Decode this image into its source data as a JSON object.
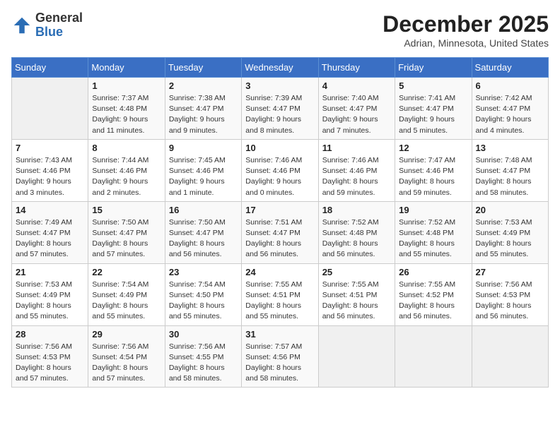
{
  "logo": {
    "general": "General",
    "blue": "Blue"
  },
  "header": {
    "title": "December 2025",
    "subtitle": "Adrian, Minnesota, United States"
  },
  "days_of_week": [
    "Sunday",
    "Monday",
    "Tuesday",
    "Wednesday",
    "Thursday",
    "Friday",
    "Saturday"
  ],
  "weeks": [
    [
      {
        "day": "",
        "detail": ""
      },
      {
        "day": "1",
        "detail": "Sunrise: 7:37 AM\nSunset: 4:48 PM\nDaylight: 9 hours\nand 11 minutes."
      },
      {
        "day": "2",
        "detail": "Sunrise: 7:38 AM\nSunset: 4:47 PM\nDaylight: 9 hours\nand 9 minutes."
      },
      {
        "day": "3",
        "detail": "Sunrise: 7:39 AM\nSunset: 4:47 PM\nDaylight: 9 hours\nand 8 minutes."
      },
      {
        "day": "4",
        "detail": "Sunrise: 7:40 AM\nSunset: 4:47 PM\nDaylight: 9 hours\nand 7 minutes."
      },
      {
        "day": "5",
        "detail": "Sunrise: 7:41 AM\nSunset: 4:47 PM\nDaylight: 9 hours\nand 5 minutes."
      },
      {
        "day": "6",
        "detail": "Sunrise: 7:42 AM\nSunset: 4:47 PM\nDaylight: 9 hours\nand 4 minutes."
      }
    ],
    [
      {
        "day": "7",
        "detail": "Sunrise: 7:43 AM\nSunset: 4:46 PM\nDaylight: 9 hours\nand 3 minutes."
      },
      {
        "day": "8",
        "detail": "Sunrise: 7:44 AM\nSunset: 4:46 PM\nDaylight: 9 hours\nand 2 minutes."
      },
      {
        "day": "9",
        "detail": "Sunrise: 7:45 AM\nSunset: 4:46 PM\nDaylight: 9 hours\nand 1 minute."
      },
      {
        "day": "10",
        "detail": "Sunrise: 7:46 AM\nSunset: 4:46 PM\nDaylight: 9 hours\nand 0 minutes."
      },
      {
        "day": "11",
        "detail": "Sunrise: 7:46 AM\nSunset: 4:46 PM\nDaylight: 8 hours\nand 59 minutes."
      },
      {
        "day": "12",
        "detail": "Sunrise: 7:47 AM\nSunset: 4:46 PM\nDaylight: 8 hours\nand 59 minutes."
      },
      {
        "day": "13",
        "detail": "Sunrise: 7:48 AM\nSunset: 4:47 PM\nDaylight: 8 hours\nand 58 minutes."
      }
    ],
    [
      {
        "day": "14",
        "detail": "Sunrise: 7:49 AM\nSunset: 4:47 PM\nDaylight: 8 hours\nand 57 minutes."
      },
      {
        "day": "15",
        "detail": "Sunrise: 7:50 AM\nSunset: 4:47 PM\nDaylight: 8 hours\nand 57 minutes."
      },
      {
        "day": "16",
        "detail": "Sunrise: 7:50 AM\nSunset: 4:47 PM\nDaylight: 8 hours\nand 56 minutes."
      },
      {
        "day": "17",
        "detail": "Sunrise: 7:51 AM\nSunset: 4:47 PM\nDaylight: 8 hours\nand 56 minutes."
      },
      {
        "day": "18",
        "detail": "Sunrise: 7:52 AM\nSunset: 4:48 PM\nDaylight: 8 hours\nand 56 minutes."
      },
      {
        "day": "19",
        "detail": "Sunrise: 7:52 AM\nSunset: 4:48 PM\nDaylight: 8 hours\nand 55 minutes."
      },
      {
        "day": "20",
        "detail": "Sunrise: 7:53 AM\nSunset: 4:49 PM\nDaylight: 8 hours\nand 55 minutes."
      }
    ],
    [
      {
        "day": "21",
        "detail": "Sunrise: 7:53 AM\nSunset: 4:49 PM\nDaylight: 8 hours\nand 55 minutes."
      },
      {
        "day": "22",
        "detail": "Sunrise: 7:54 AM\nSunset: 4:49 PM\nDaylight: 8 hours\nand 55 minutes."
      },
      {
        "day": "23",
        "detail": "Sunrise: 7:54 AM\nSunset: 4:50 PM\nDaylight: 8 hours\nand 55 minutes."
      },
      {
        "day": "24",
        "detail": "Sunrise: 7:55 AM\nSunset: 4:51 PM\nDaylight: 8 hours\nand 55 minutes."
      },
      {
        "day": "25",
        "detail": "Sunrise: 7:55 AM\nSunset: 4:51 PM\nDaylight: 8 hours\nand 56 minutes."
      },
      {
        "day": "26",
        "detail": "Sunrise: 7:55 AM\nSunset: 4:52 PM\nDaylight: 8 hours\nand 56 minutes."
      },
      {
        "day": "27",
        "detail": "Sunrise: 7:56 AM\nSunset: 4:53 PM\nDaylight: 8 hours\nand 56 minutes."
      }
    ],
    [
      {
        "day": "28",
        "detail": "Sunrise: 7:56 AM\nSunset: 4:53 PM\nDaylight: 8 hours\nand 57 minutes."
      },
      {
        "day": "29",
        "detail": "Sunrise: 7:56 AM\nSunset: 4:54 PM\nDaylight: 8 hours\nand 57 minutes."
      },
      {
        "day": "30",
        "detail": "Sunrise: 7:56 AM\nSunset: 4:55 PM\nDaylight: 8 hours\nand 58 minutes."
      },
      {
        "day": "31",
        "detail": "Sunrise: 7:57 AM\nSunset: 4:56 PM\nDaylight: 8 hours\nand 58 minutes."
      },
      {
        "day": "",
        "detail": ""
      },
      {
        "day": "",
        "detail": ""
      },
      {
        "day": "",
        "detail": ""
      }
    ]
  ]
}
